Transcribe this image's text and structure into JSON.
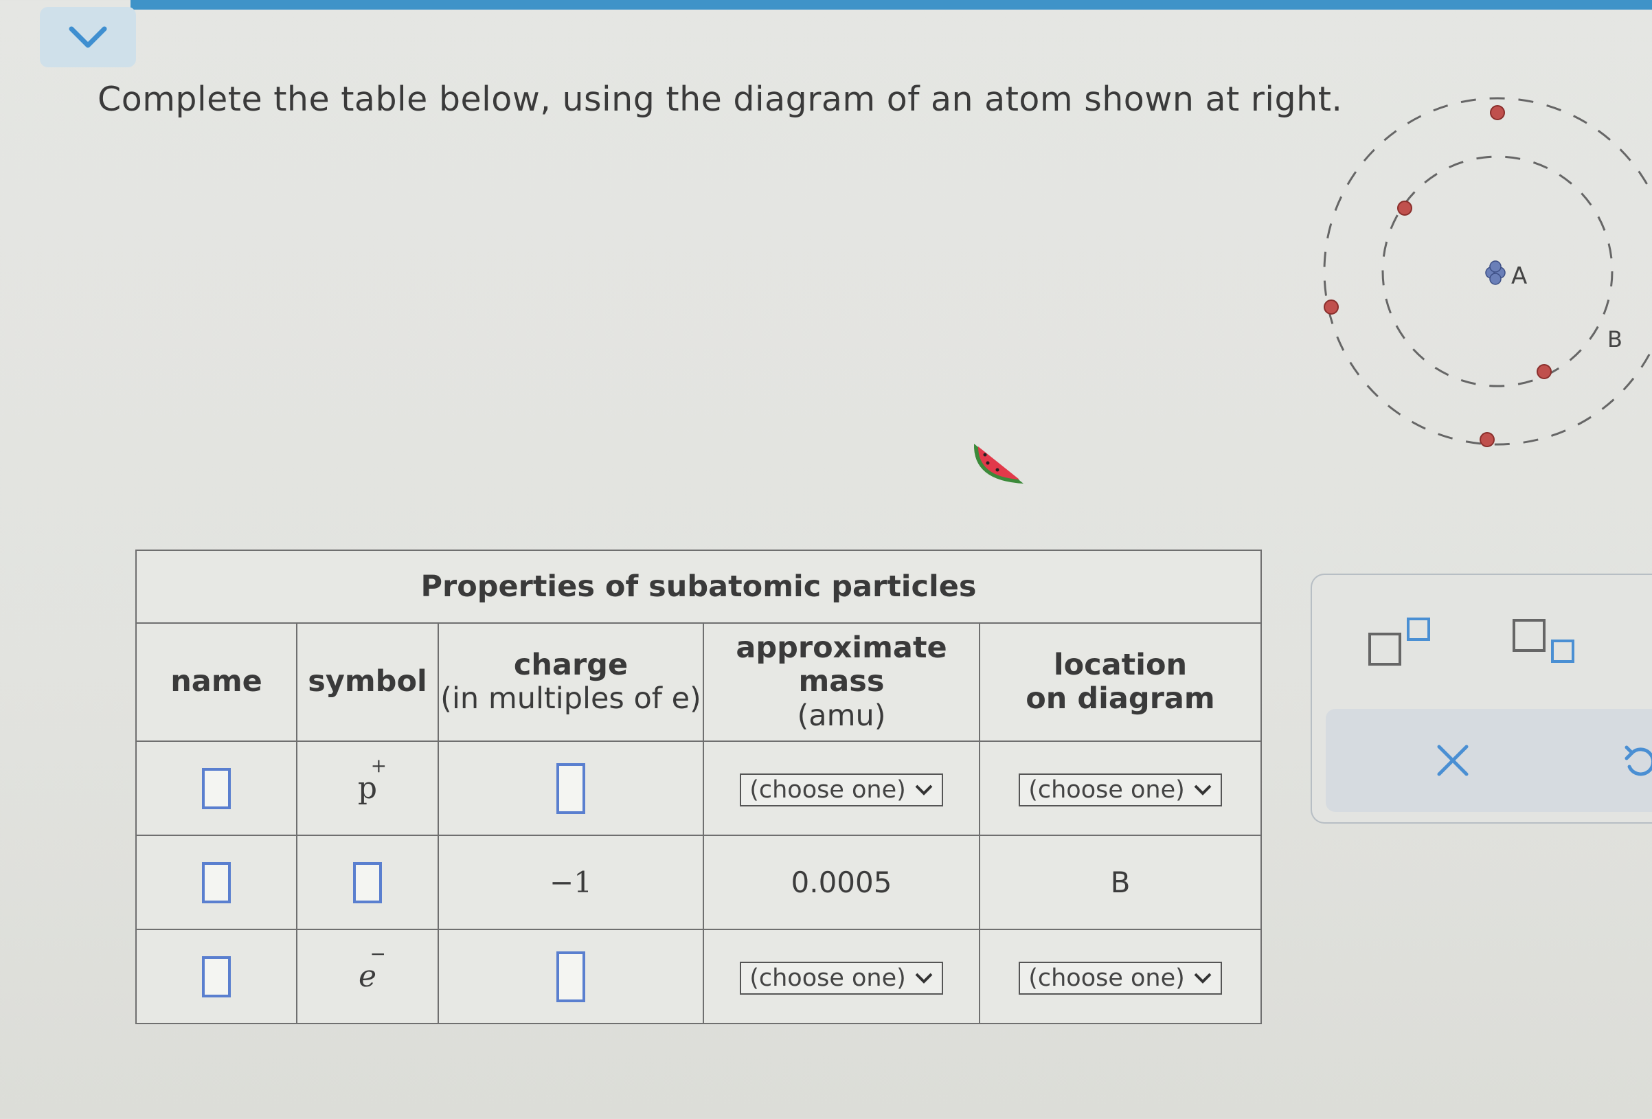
{
  "prompt": "Complete the table below, using the diagram of an atom shown at right.",
  "table": {
    "caption": "Properties of subatomic particles",
    "headers": {
      "name": "name",
      "symbol": "symbol",
      "charge_main": "charge",
      "charge_sub": "(in multiples of e)",
      "mass_main": "approximate mass",
      "mass_sub": "(amu)",
      "location_main": "location",
      "location_sub": "on diagram"
    },
    "rows": [
      {
        "symbol_base": "p",
        "symbol_charge": "+",
        "mass_select": "(choose one)",
        "location_select": "(choose one)"
      },
      {
        "charge": "−1",
        "mass": "0.0005",
        "location": "B"
      },
      {
        "symbol_base": "e",
        "symbol_charge": "−",
        "mass_select": "(choose one)",
        "location_select": "(choose one)"
      }
    ]
  },
  "atom": {
    "label_a": "A",
    "label_b": "B"
  },
  "colors": {
    "accent": "#3f93c8",
    "answer_box": "#5a7fcf",
    "electron": "#c0504d"
  },
  "icons": [
    "chevron-down-icon",
    "superscript-icon",
    "subscript-icon",
    "clear-icon",
    "undo-icon",
    "watermelon-icon"
  ]
}
